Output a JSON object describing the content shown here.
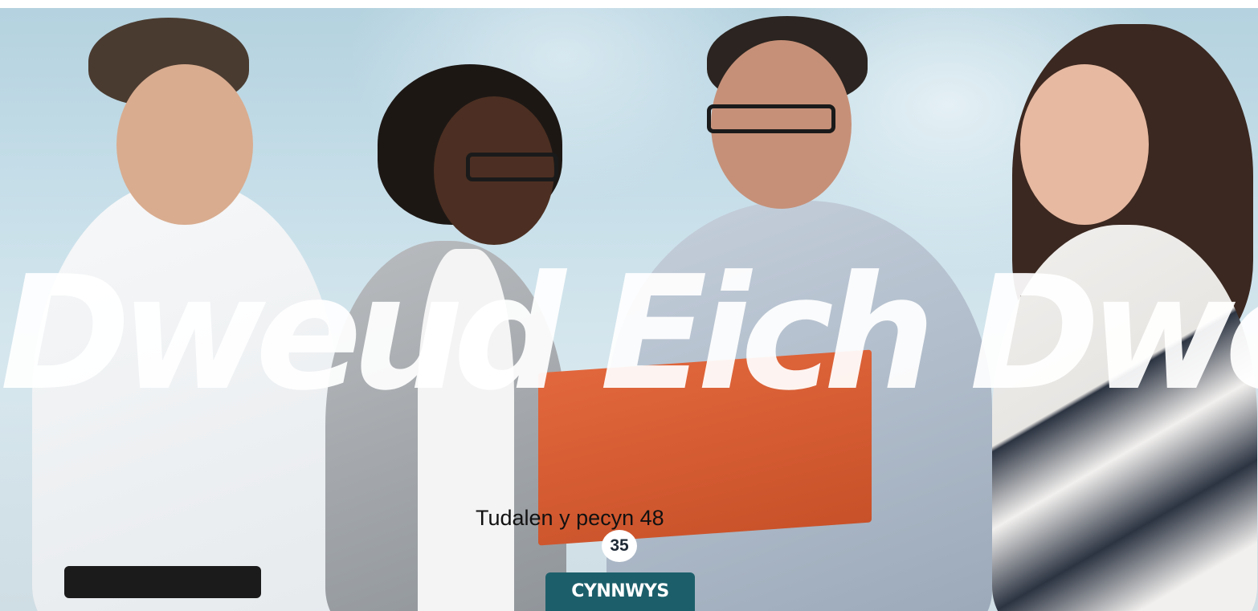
{
  "cover": {
    "headline": "Dweud Eich Dweud",
    "package_page_note": "Tudalen y pecyn 48",
    "page_number": "35",
    "contents_link_label": "CYNNWYS"
  },
  "colors": {
    "contents_tab": "#1c5f6b",
    "headline_text": "#ffffff",
    "folder_accent": "#e2673c"
  }
}
